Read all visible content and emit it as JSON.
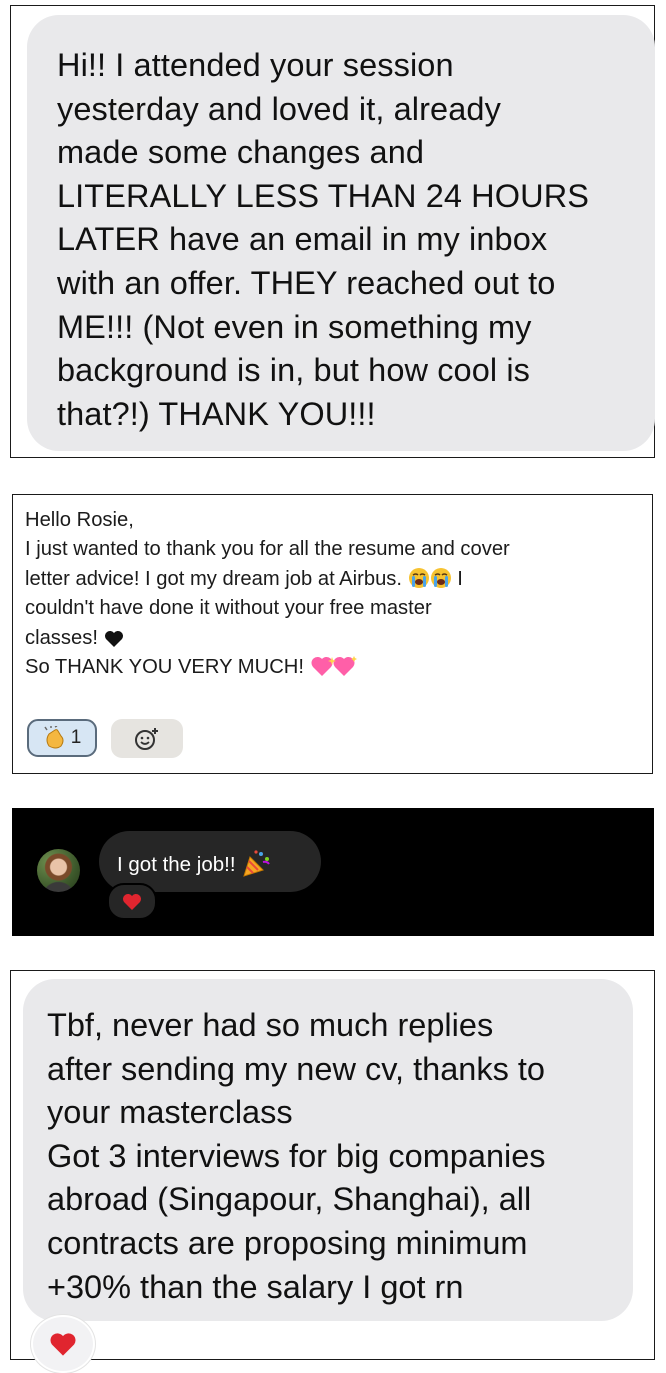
{
  "card1": {
    "lines": [
      "Hi!! I attended your session",
      "yesterday and loved it, already",
      "made some changes and",
      "LITERALLY LESS THAN 24 HOURS",
      "LATER have an email in my inbox",
      "with an offer. THEY reached out to",
      "ME!!! (Not even in something my",
      "background is in, but how cool is",
      "that?!) THANK YOU!!!"
    ]
  },
  "card2": {
    "greeting": "Hello Rosie,",
    "line1": "I just wanted to thank you for all the resume and cover",
    "line2": "letter advice! I got my dream job at Airbus.",
    "line2_end": "I",
    "line3": "couldn't have done it without your free master",
    "line4": "classes!",
    "line5": "So THANK YOU VERY MUCH!",
    "clap_count": "1",
    "icons": [
      "crying-face-icon",
      "black-heart-icon",
      "sparkling-heart-icon",
      "clapping-hands-icon",
      "add-reaction-icon"
    ]
  },
  "card3": {
    "message": "I got the job!!",
    "icons": [
      "avatar",
      "party-popper-icon",
      "red-heart-icon"
    ]
  },
  "card4": {
    "lines": [
      "Tbf, never had so much replies",
      "after sending my new cv, thanks to",
      "your masterclass",
      "Got 3 interviews for big companies",
      "abroad (Singapour, Shanghai), all",
      "contracts are proposing minimum",
      "+30% than the salary I got rn"
    ],
    "icons": [
      "red-heart-icon"
    ]
  },
  "colors": {
    "bubble_gray": "#e9e9eb",
    "dm_bubble": "#262626",
    "clap_reaction_bg": "#d7e6f4",
    "heart_red": "#e0252f"
  }
}
